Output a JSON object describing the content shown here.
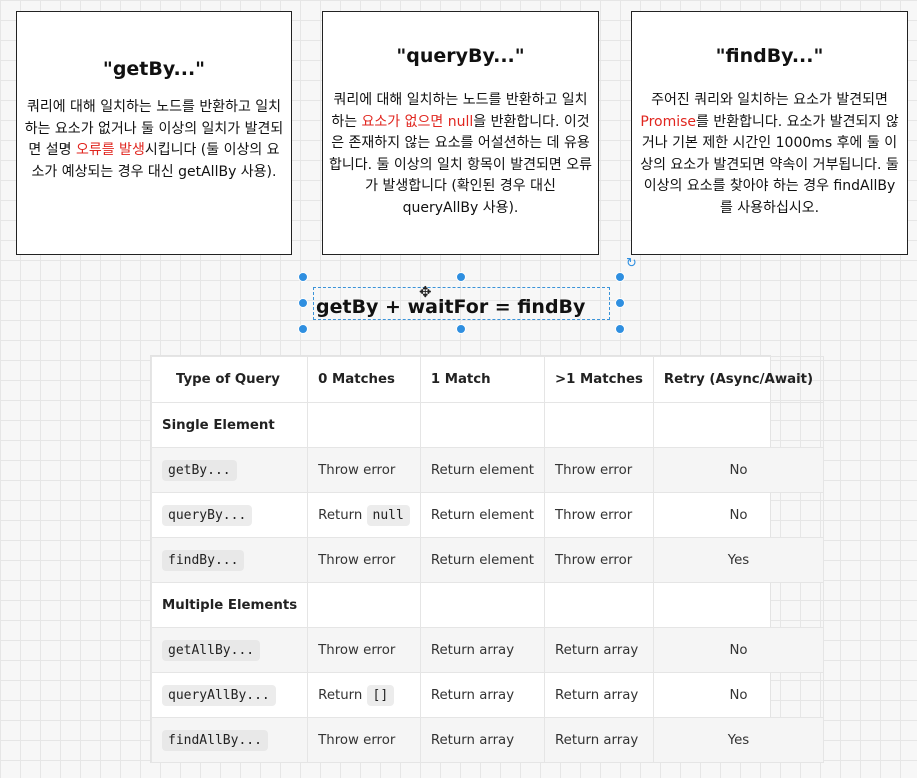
{
  "cards": [
    {
      "title": "\"getBy...\"",
      "desc_parts": [
        "쿼리에 대해 일치하는 노드를 반환하고 일치하는 요소가 없거나 둘 이상의 일치가 발견되면 설명 ",
        "오류를 발생",
        "시킵니다 (둘 이상의 요소가 예상되는 경우 대신 getAllBy 사용)."
      ]
    },
    {
      "title": "\"queryBy...\"",
      "desc_parts": [
        "쿼리에 대해 일치하는 노드를 반환하고 일치하는 ",
        "요소가 없으면 null",
        "을 반환합니다. 이것은 존재하지 않는 요소를 어설션하는 데 유용합니다. 둘 이상의 일치 항목이 발견되면 오류가 발생합니다 (확인된 경우 대신 queryAllBy 사용)."
      ]
    },
    {
      "title": "\"findBy...\"",
      "desc_parts": [
        "주어진 쿼리와 일치하는 요소가 발견되면 ",
        "Promise",
        "를 반환합니다. 요소가 발견되지 않거나 기본 제한 시간인 1000ms 후에 둘 이상의 요소가 발견되면 약속이 거부됩니다. 둘 이상의 요소를 찾아야 하는 경우 findAllBy를 사용하십시오."
      ]
    }
  ],
  "formula": "getBy + waitFor = findBy",
  "table": {
    "headers": [
      "Type of Query",
      "0 Matches",
      "1 Match",
      ">1 Matches",
      "Retry (Async/Await)"
    ],
    "sections": [
      "Single Element",
      "Multiple Elements"
    ],
    "rows": [
      {
        "query": "getBy...",
        "zero_text": "Throw error",
        "zero_code": "",
        "one": "Return element",
        "many": "Throw error",
        "retry": "No"
      },
      {
        "query": "queryBy...",
        "zero_text": "Return",
        "zero_code": "null",
        "one": "Return element",
        "many": "Throw error",
        "retry": "No"
      },
      {
        "query": "findBy...",
        "zero_text": "Throw error",
        "zero_code": "",
        "one": "Return element",
        "many": "Throw error",
        "retry": "Yes"
      },
      {
        "query": "getAllBy...",
        "zero_text": "Throw error",
        "zero_code": "",
        "one": "Return array",
        "many": "Return array",
        "retry": "No"
      },
      {
        "query": "queryAllBy...",
        "zero_text": "Return",
        "zero_code": "[]",
        "one": "Return array",
        "many": "Return array",
        "retry": "No"
      },
      {
        "query": "findAllBy...",
        "zero_text": "Throw error",
        "zero_code": "",
        "one": "Return array",
        "many": "Return array",
        "retry": "Yes"
      }
    ]
  },
  "colors": {
    "accent_red": "#e0261f",
    "selection_blue": "#2f8fe0"
  },
  "icons": {
    "move": "move-cursor-icon",
    "rotate": "rotate-handle-icon"
  }
}
